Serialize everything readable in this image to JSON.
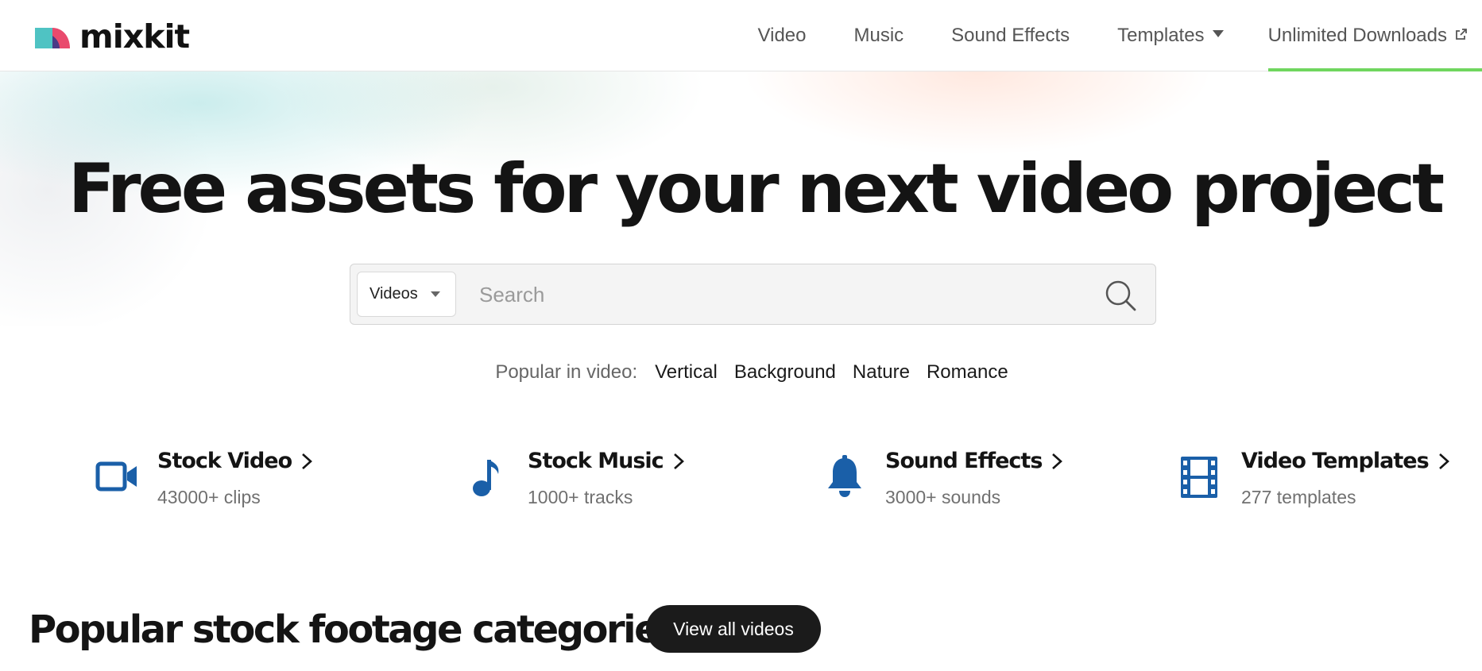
{
  "brand": {
    "name": "mixkit"
  },
  "nav": {
    "video": "Video",
    "music": "Music",
    "sound_effects": "Sound Effects",
    "templates": "Templates",
    "unlimited": "Unlimited Downloads",
    "active_underline_color": "#6fd65e"
  },
  "hero": {
    "title": "Free assets for your next video project"
  },
  "search": {
    "type_selected": "Videos",
    "placeholder": "Search"
  },
  "popular": {
    "label": "Popular in video:",
    "tags": [
      "Vertical",
      "Background",
      "Nature",
      "Romance"
    ]
  },
  "categories": [
    {
      "title": "Stock Video",
      "subtitle": "43000+ clips",
      "icon": "video-camera-icon"
    },
    {
      "title": "Stock Music",
      "subtitle": "1000+ tracks",
      "icon": "music-note-icon"
    },
    {
      "title": "Sound Effects",
      "subtitle": "3000+ sounds",
      "icon": "bell-icon"
    },
    {
      "title": "Video Templates",
      "subtitle": "277 templates",
      "icon": "film-strip-icon"
    }
  ],
  "section": {
    "title": "Popular stock footage categories",
    "button": "View all videos"
  },
  "colors": {
    "icon_blue": "#1a5fa8",
    "dark_button": "#1b1b1b",
    "logo_teal": "#4fc3c3",
    "logo_pink": "#e94a6d",
    "logo_purple": "#4a3a86"
  }
}
